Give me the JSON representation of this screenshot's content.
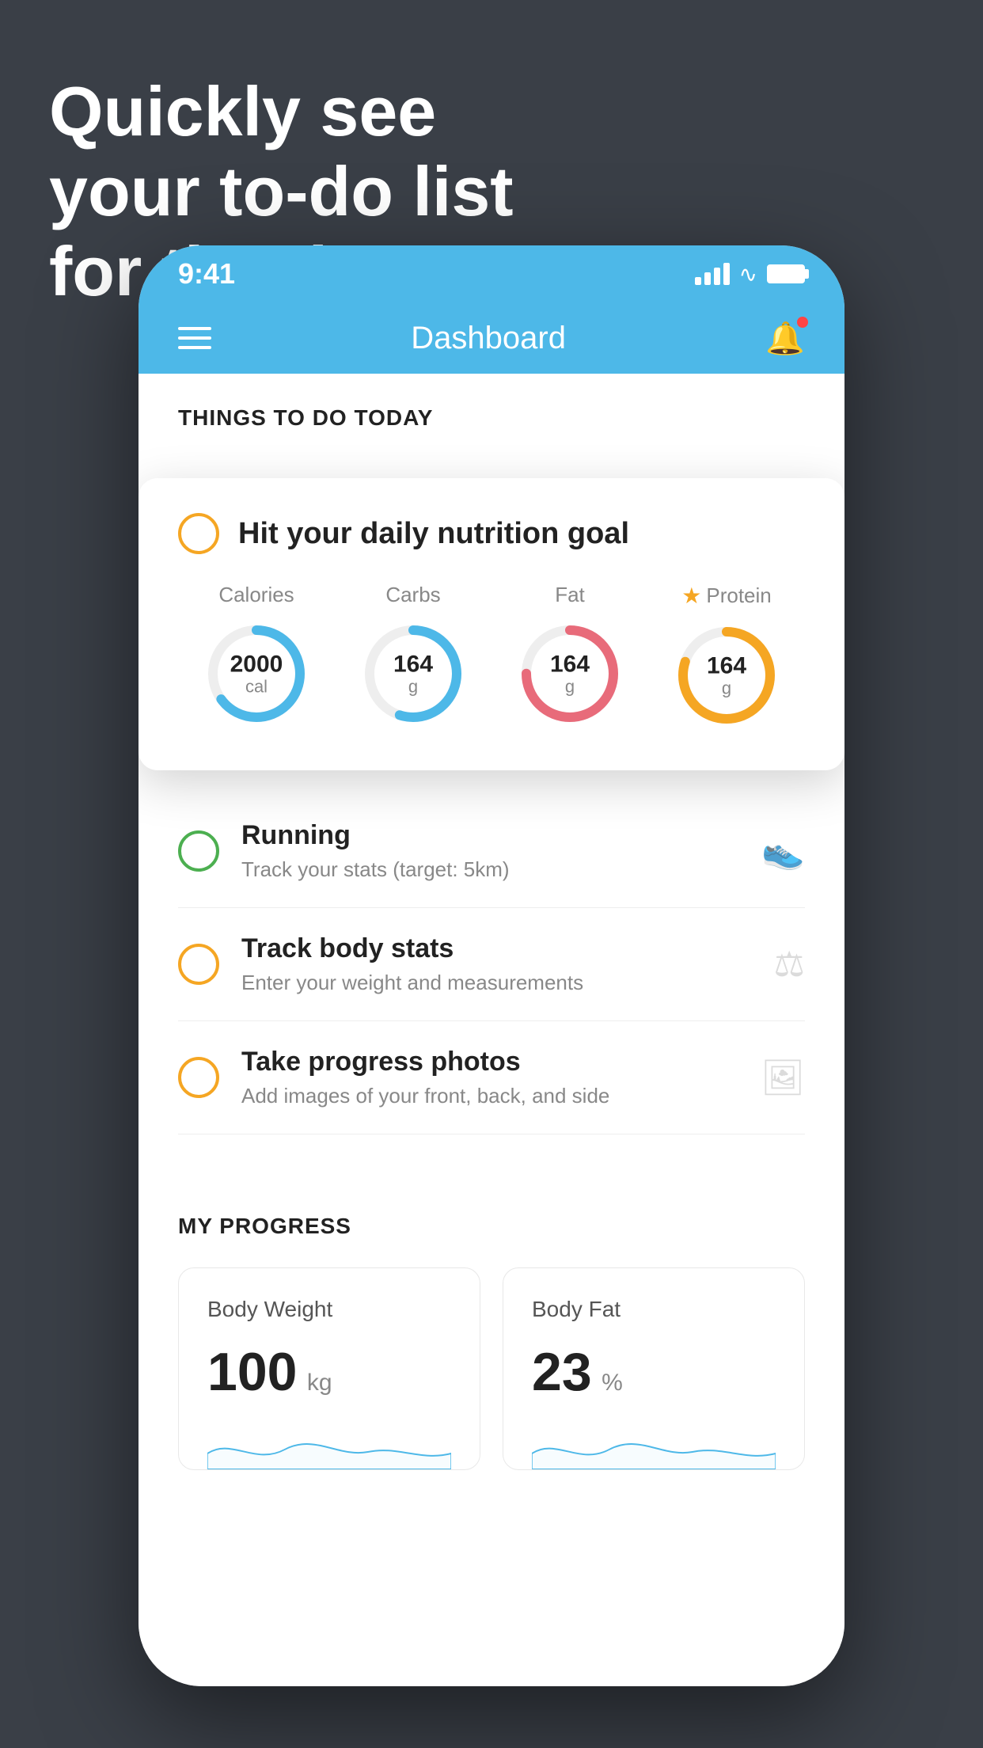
{
  "hero": {
    "line1": "Quickly see",
    "line2": "your to-do list",
    "line3": "for the day."
  },
  "statusBar": {
    "time": "9:41"
  },
  "navBar": {
    "title": "Dashboard"
  },
  "thingsToDo": {
    "sectionHeader": "THINGS TO DO TODAY",
    "card": {
      "title": "Hit your daily nutrition goal",
      "nutrition": [
        {
          "label": "Calories",
          "value": "2000",
          "unit": "cal",
          "color": "#4db8e8",
          "progress": 0.65
        },
        {
          "label": "Carbs",
          "value": "164",
          "unit": "g",
          "color": "#4db8e8",
          "progress": 0.55
        },
        {
          "label": "Fat",
          "value": "164",
          "unit": "g",
          "color": "#e86b7a",
          "progress": 0.75
        },
        {
          "label": "Protein",
          "value": "164",
          "unit": "g",
          "color": "#f5a623",
          "progress": 0.8,
          "star": true
        }
      ]
    },
    "items": [
      {
        "title": "Running",
        "subtitle": "Track your stats (target: 5km)",
        "icon": "👟",
        "checkColor": "green"
      },
      {
        "title": "Track body stats",
        "subtitle": "Enter your weight and measurements",
        "icon": "⚖",
        "checkColor": "yellow"
      },
      {
        "title": "Take progress photos",
        "subtitle": "Add images of your front, back, and side",
        "icon": "🖼",
        "checkColor": "yellow"
      }
    ]
  },
  "myProgress": {
    "sectionTitle": "MY PROGRESS",
    "cards": [
      {
        "title": "Body Weight",
        "value": "100",
        "unit": "kg"
      },
      {
        "title": "Body Fat",
        "value": "23",
        "unit": "%"
      }
    ]
  }
}
